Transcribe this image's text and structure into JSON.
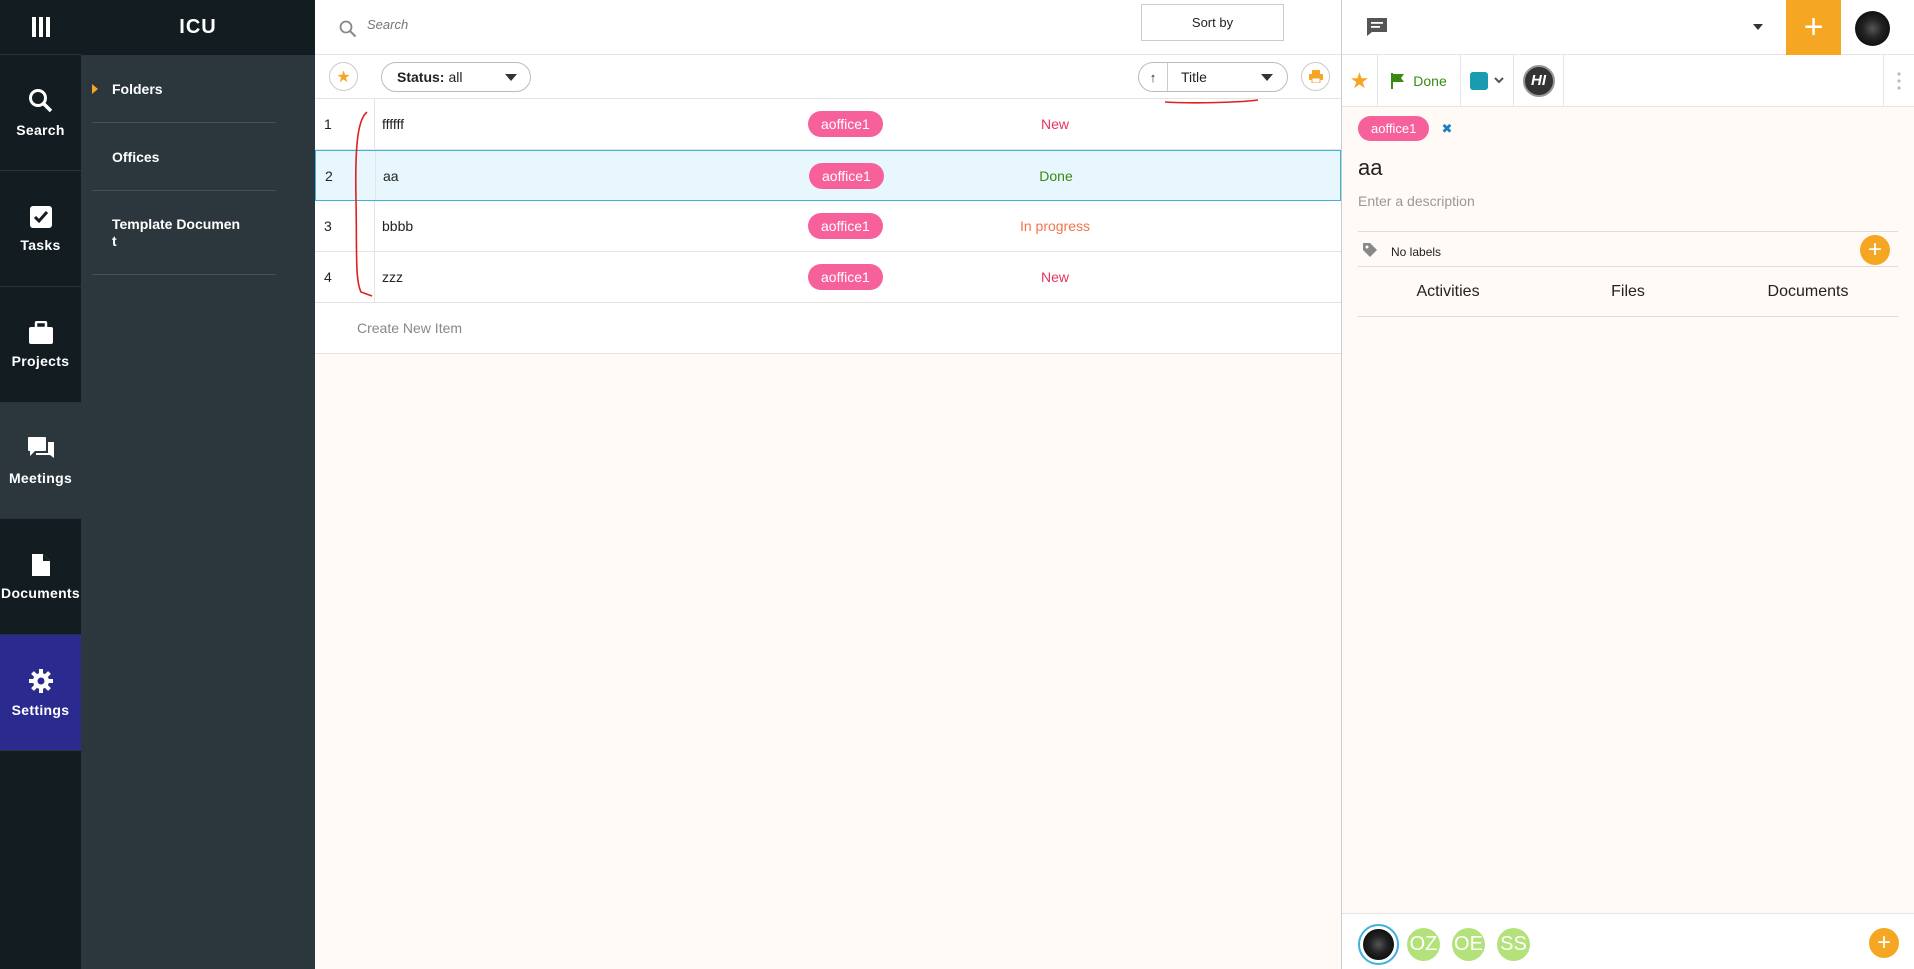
{
  "app": {
    "name": "ICU"
  },
  "nav": {
    "items": [
      {
        "label": "Search",
        "icon": "search-icon"
      },
      {
        "label": "Tasks",
        "icon": "check-icon"
      },
      {
        "label": "Projects",
        "icon": "briefcase-icon"
      },
      {
        "label": "Meetings",
        "icon": "chat-bubbles-icon"
      },
      {
        "label": "Documents",
        "icon": "document-icon"
      },
      {
        "label": "Settings",
        "icon": "gear-icon"
      }
    ]
  },
  "tree": {
    "items": [
      {
        "label": "Folders"
      },
      {
        "label": "Offices"
      },
      {
        "label": "Template Documen t"
      }
    ]
  },
  "search": {
    "placeholder": "Search"
  },
  "sort": {
    "tooltip": "Sort by",
    "field": "Title",
    "direction": "↑"
  },
  "filter": {
    "status_label": "Status:",
    "status_value": "all"
  },
  "list": {
    "rows": [
      {
        "num": "1",
        "title": "ffffff",
        "tag": "aoffice1",
        "status": "New",
        "color": "#e8345e"
      },
      {
        "num": "2",
        "title": "aa",
        "tag": "aoffice1",
        "status": "Done",
        "color": "#3a8a12"
      },
      {
        "num": "3",
        "title": "bbbb",
        "tag": "aoffice1",
        "status": "In progress",
        "color": "#f2744a"
      },
      {
        "num": "4",
        "title": "zzz",
        "tag": "aoffice1",
        "status": "New",
        "color": "#e8345e"
      }
    ],
    "create_label": "Create New Item"
  },
  "detail": {
    "status": "Done",
    "tag": "aoffice1",
    "title": "aa",
    "description_placeholder": "Enter a description",
    "labels_text": "No labels",
    "tabs": [
      "Activities",
      "Files",
      "Documents"
    ],
    "color_swatch": "#1a9bb2",
    "watchers": [
      "OZ",
      "OE",
      "SS"
    ]
  },
  "colors": {
    "accent": "#f5a623",
    "tag": "#f7619b",
    "settings_bg": "#2b2a8f"
  }
}
